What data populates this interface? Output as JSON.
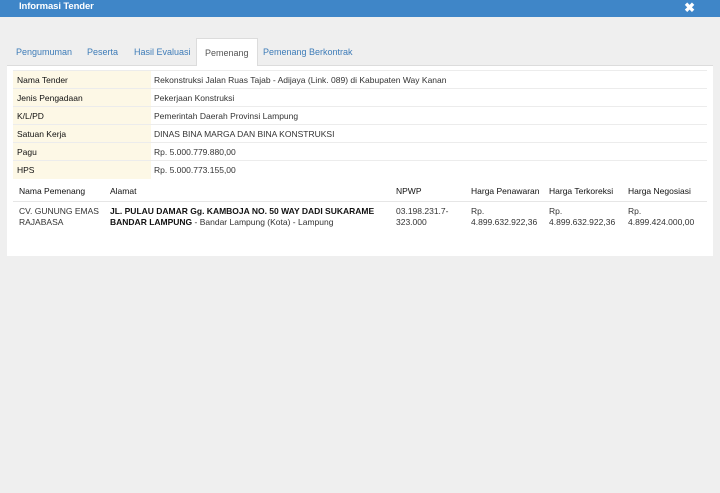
{
  "window": {
    "title": "Informasi Tender",
    "close_glyph": "✖"
  },
  "tabs": [
    {
      "label": "Pengumuman",
      "active": false
    },
    {
      "label": "Peserta",
      "active": false
    },
    {
      "label": "Hasil Evaluasi",
      "active": false
    },
    {
      "label": "Pemenang",
      "active": true
    },
    {
      "label": "Pemenang Berkontrak",
      "active": false
    }
  ],
  "info": [
    {
      "label": "Nama Tender",
      "value": "Rekonstruksi Jalan Ruas Tajab - Adijaya (Link. 089) di Kabupaten Way Kanan"
    },
    {
      "label": "Jenis Pengadaan",
      "value": "Pekerjaan Konstruksi"
    },
    {
      "label": "K/L/PD",
      "value": "Pemerintah Daerah Provinsi Lampung"
    },
    {
      "label": "Satuan Kerja",
      "value": "DINAS BINA MARGA DAN BINA KONSTRUKSI"
    },
    {
      "label": "Pagu",
      "value": "Rp. 5.000.779.880,00"
    },
    {
      "label": "HPS",
      "value": "Rp. 5.000.773.155,00"
    }
  ],
  "winners": {
    "headers": [
      "Nama Pemenang",
      "Alamat",
      "NPWP",
      "Harga Penawaran",
      "Harga Terkoreksi",
      "Harga Negosiasi"
    ],
    "rows": [
      {
        "name": "CV. GUNUNG EMAS RAJABASA",
        "address_bold": "JL. PULAU DAMAR Gg. KAMBOJA NO. 50 WAY DADI SUKARAME BANDAR LAMPUNG",
        "address_rest": " - Bandar Lampung (Kota) - Lampung",
        "npwp": "03.198.231.7-323.000",
        "harga_penawaran": "Rp. 4.899.632.922,36",
        "harga_terkoreksi": "Rp. 4.899.632.922,36",
        "harga_negosiasi": "Rp. 4.899.424.000,00"
      }
    ]
  }
}
